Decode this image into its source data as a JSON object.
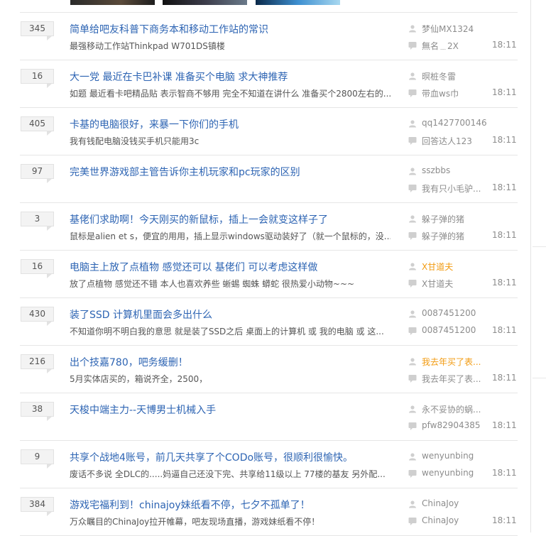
{
  "threads": [
    {
      "replies": "345",
      "title": "简单给吧友科普下商务本和移动工作站的常识",
      "excerpt": "最强移动工作站Thinkpad W701DS镇楼",
      "author": "梦仙MX1324",
      "author_highlight": false,
      "last_reply": "無名﹍2X",
      "time": "18:11"
    },
    {
      "replies": "16",
      "title": "大一党 最近在卡巴补课 准备买个电脑 求大神推荐",
      "excerpt": "如题 最近看卡吧精品贴 表示智商不够用 完全不知道在讲什么 准备买个2800左右的...",
      "author": "暝桩冬雷",
      "author_highlight": false,
      "last_reply": "带血ws巾",
      "time": "18:11"
    },
    {
      "replies": "405",
      "title": "卡基的电脑很好，来暴一下你们的手机",
      "excerpt": "我有钱配电脑没钱买手机只能用3c",
      "author": "qq1427700146",
      "author_highlight": false,
      "last_reply": "回答达人123",
      "time": "18:11"
    },
    {
      "replies": "97",
      "title": "完美世界游戏部主管告诉你主机玩家和pc玩家的区别",
      "excerpt": "",
      "author": "sszbbs",
      "author_highlight": false,
      "last_reply": "我有只小毛驴...",
      "time": "18:11"
    },
    {
      "replies": "3",
      "title": "基佬们求助啊！今天刚买的新鼠标，插上一会就变这样子了",
      "excerpt": "鼠标是alien et s，便宜的用用，插上显示windows驱动装好了（就一个鼠标的，没...",
      "author": "躲子弹的猪",
      "author_highlight": false,
      "last_reply": "躲子弹的猪",
      "time": "18:11"
    },
    {
      "replies": "16",
      "title": "电脑主上放了点植物 感觉还可以 基佬们 可以考虑这样做",
      "excerpt": "放了点植物 感觉还不错 本人也喜欢养些 蜥蜴 蜘蛛 蟒蛇 很热爱小动物~~~",
      "author": "X甘道夫",
      "author_highlight": true,
      "last_reply": "X甘道夫",
      "time": "18:11"
    },
    {
      "replies": "430",
      "title": "装了SSD 计算机里面会多出什么",
      "excerpt": "不知道你明不明白我的意思 就是装了SSD之后 桌面上的计算机 或 我的电脑 或 这...",
      "author": "0087451200",
      "author_highlight": false,
      "last_reply": "0087451200",
      "time": "18:11"
    },
    {
      "replies": "216",
      "title": "出个技嘉780，吧务缓删！",
      "excerpt": "5月实体店买的，箱说齐全，2500，",
      "author": "我去年买了表...",
      "author_highlight": true,
      "last_reply": "我去年买了表...",
      "time": "18:11"
    },
    {
      "replies": "38",
      "title": "天梭中端主力--天博男士机械入手",
      "excerpt": "",
      "author": "永不妥协的蜗...",
      "author_highlight": false,
      "last_reply": "pfw82904385",
      "time": "18:11"
    },
    {
      "replies": "9",
      "title": "共享个战地4账号，前几天共享了个CODo账号，很顺利很愉快。",
      "excerpt": "废话不多说 全DLC的.....妈逼自己还没下完、共享给11级以上 77楼的基友 另外配...",
      "author": "wenyunbing",
      "author_highlight": false,
      "last_reply": "wenyunbing",
      "time": "18:11"
    },
    {
      "replies": "384",
      "title": "游戏宅福利到！chinajoy妹纸看不停，七夕不孤单了！",
      "excerpt": "万众瞩目的ChinaJoy拉开帷幕，吧友现场直播，游戏妹纸看不停！",
      "author": "ChinaJoy",
      "author_highlight": false,
      "last_reply": "ChinaJoy",
      "time": "18:11"
    }
  ],
  "colors": {
    "title": "#2d64b3",
    "highlight": "#f29b11",
    "meta": "#8c8c8c"
  },
  "icons": {
    "author": "user-icon",
    "last_reply": "speech-bubble-icon"
  }
}
